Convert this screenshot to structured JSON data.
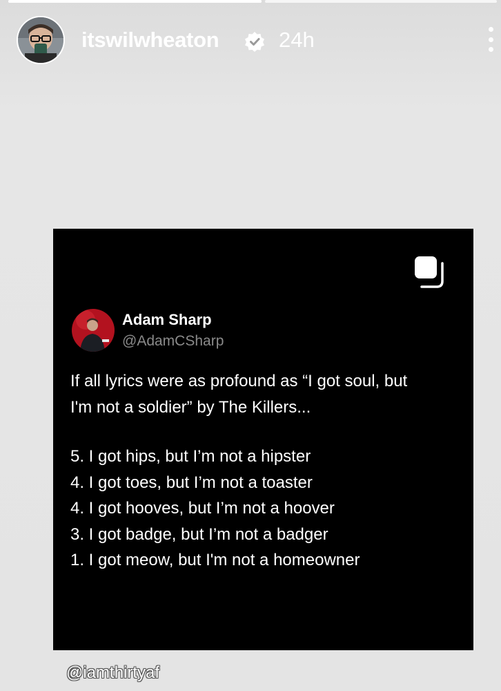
{
  "story": {
    "progress": [
      1.0,
      0.0
    ],
    "username": "itswilwheaton",
    "verified": true,
    "time": "24h",
    "mention": "@iamthirtyaf"
  },
  "icons": {
    "verified": "verified-badge-icon",
    "more": "more-vertical-icon",
    "copy": "copy-icon"
  },
  "post": {
    "author_name": "Adam Sharp",
    "author_handle": "@AdamCSharp",
    "text_line1": "If all lyrics were as profound as “I got soul, but",
    "text_line2": "I'm not a soldier” by The Killers...",
    "list": [
      "5. I got hips, but I’m not a hipster",
      "4. I got toes, but I’m not a toaster",
      "4. I got hooves, but I’m not a hoover",
      "3. I got badge, but I’m not a badger",
      "1. I got meow, but I'm not a homeowner"
    ]
  },
  "colors": {
    "story_background": "#e4e4e4",
    "post_background": "#000000",
    "handle_gray": "#8a8a8a",
    "avatar_red": "#b3121f"
  }
}
